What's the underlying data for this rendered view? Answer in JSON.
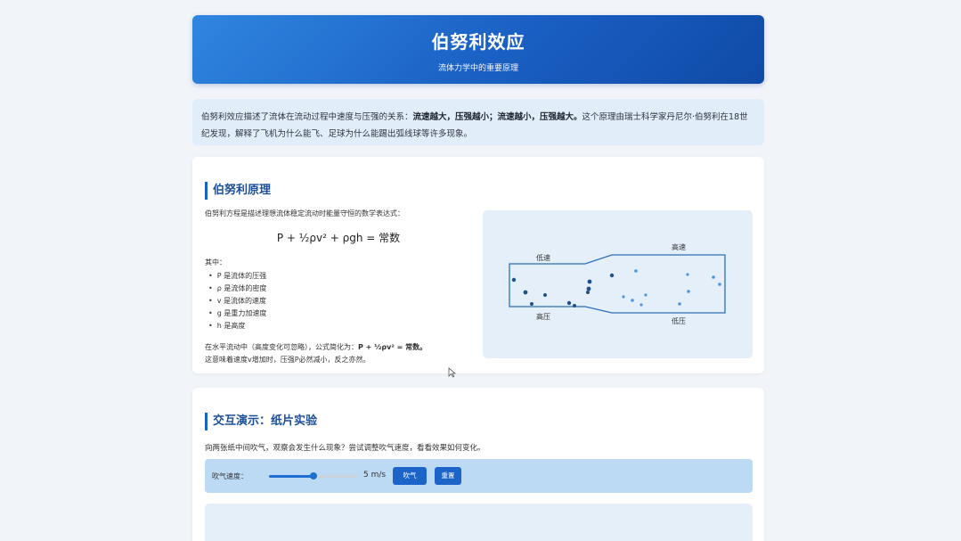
{
  "header": {
    "title": "伯努利效应",
    "subtitle": "流体力学中的重要原理"
  },
  "intro": {
    "text_before": "伯努利效应描述了流体在流动过程中速度与压强的关系：",
    "emphasis": "流速越大，压强越小；流速越小，压强越大。",
    "text_after": "这个原理由瑞士科学家丹尼尔·伯努利在18世纪发现，解释了飞机为什么能飞、足球为什么能踢出弧线球等许多现象。"
  },
  "principle": {
    "title": "伯努利原理",
    "lead": "伯努利方程是描述理想流体稳定流动时能量守恒的数学表达式：",
    "formula": "P + ½ρv² + ρgh = 常数",
    "where": "其中：",
    "terms": [
      "P 是流体的压强",
      "ρ 是流体的密度",
      "v 是流体的速度",
      "g 是重力加速度",
      "h 是高度"
    ],
    "simplified_before": "在水平流动中（高度变化可忽略），公式简化为：",
    "simplified_formula": "P + ½ρv² = 常数。",
    "conclusion": "这意味着速度v增加时，压强P必然减小，反之亦然。"
  },
  "diagram": {
    "label_low_speed": "低速",
    "label_high_speed": "高速",
    "label_high_pressure": "高压",
    "label_low_pressure": "低压",
    "slow_color": "#1f4f8c",
    "fast_color": "#4a97e0"
  },
  "demo": {
    "title": "交互演示：纸片实验",
    "description": "向两张纸中间吹气，观察会发生什么现象？尝试调整吹气速度，看看效果如何变化。",
    "speed_label": "吹气速度：",
    "speed_value": 5,
    "speed_max": 10,
    "speed_display": "5 m/s",
    "blow_button": "吹气",
    "reset_button": "重置"
  }
}
